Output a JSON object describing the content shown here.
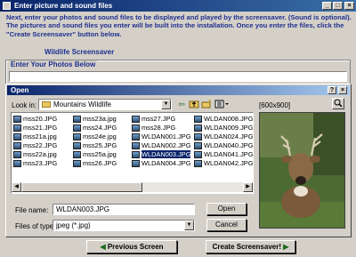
{
  "window": {
    "title": "Enter picture and sound files"
  },
  "instructions": "Next, enter your photos and sound files to be displayed and played by the screensaver. (Sound is optional). The pictures and sound files you enter will be built into the installation. Once you enter the files, click the \"Create Screensaver\" button below.",
  "screensaver_name": "Wildlife Screensaver",
  "photos_group": {
    "label": "Enter Your Photos Below"
  },
  "dialog": {
    "title": "Open",
    "look_in_label": "Look in:",
    "look_in_value": "Mountains Wildlife",
    "preview_size": "[600x900]",
    "columns": [
      [
        "mss20.JPG",
        "mss21.JPG",
        "mss21a.jpg",
        "mss22.JPG",
        "mss22a.jpg",
        "mss23.JPG"
      ],
      [
        "mss23a.jpg",
        "mss24.JPG",
        "mss24e.jpg",
        "mss25.JPG",
        "mss25a.jpg",
        "mss26.JPG"
      ],
      [
        "mss27.JPG",
        "mss28.JPG",
        "WLDAN001.JPG",
        "WLDAN002.JPG",
        "WLDAN003.JPG",
        "WLDAN004.JPG"
      ],
      [
        "WLDAN008.JPG",
        "WLDAN009.JPG",
        "WLDAN024.JPG",
        "WLDAN040.JPG",
        "WLDAN041.JPG",
        "WLDAN042.JPG"
      ]
    ],
    "file_name_label": "File name:",
    "file_name_value": "WLDAN003.JPG",
    "file_type_label": "Files of type:",
    "file_type_value": "jpeg (*.jpg)",
    "open_label": "Open",
    "cancel_label": "Cancel"
  },
  "footer": {
    "previous_label": "Previous Screen",
    "create_label": "Create Screensaver!"
  }
}
